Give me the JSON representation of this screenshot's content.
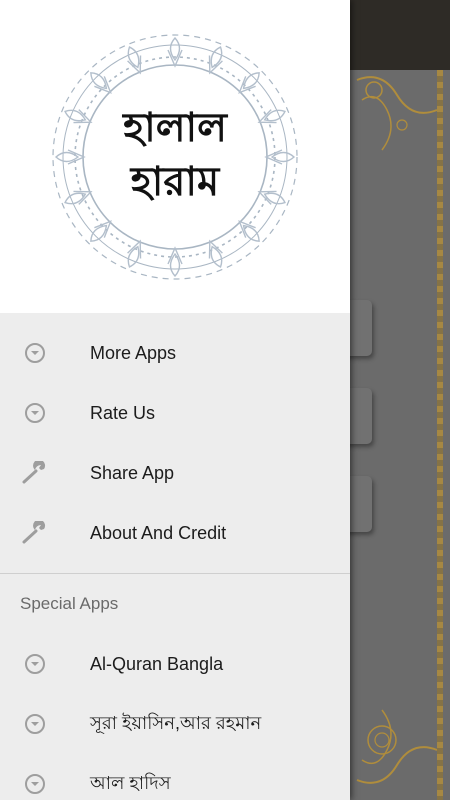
{
  "header": {
    "logo_line1": "হালাল",
    "logo_line2": "হারাম"
  },
  "menu": [
    {
      "label": "More Apps",
      "icon": "chevron-down-circle-icon"
    },
    {
      "label": "Rate Us",
      "icon": "chevron-down-circle-icon"
    },
    {
      "label": "Share App",
      "icon": "wrench-icon"
    },
    {
      "label": "About And Credit",
      "icon": "wrench-icon"
    }
  ],
  "special_section": {
    "title": "Special Apps",
    "items": [
      {
        "label": "Al-Quran Bangla",
        "icon": "chevron-down-circle-icon"
      },
      {
        "label": "সূরা ইয়াসিন,আর রহমান",
        "icon": "chevron-down-circle-icon"
      },
      {
        "label": "আল হাদিস",
        "icon": "chevron-down-circle-icon"
      }
    ]
  },
  "colors": {
    "drawer_bg": "#ededed",
    "header_bg": "#ffffff",
    "icon_gray": "#9e9e9e",
    "scrim": "#666666",
    "ornament_gold": "#b08d3c"
  }
}
